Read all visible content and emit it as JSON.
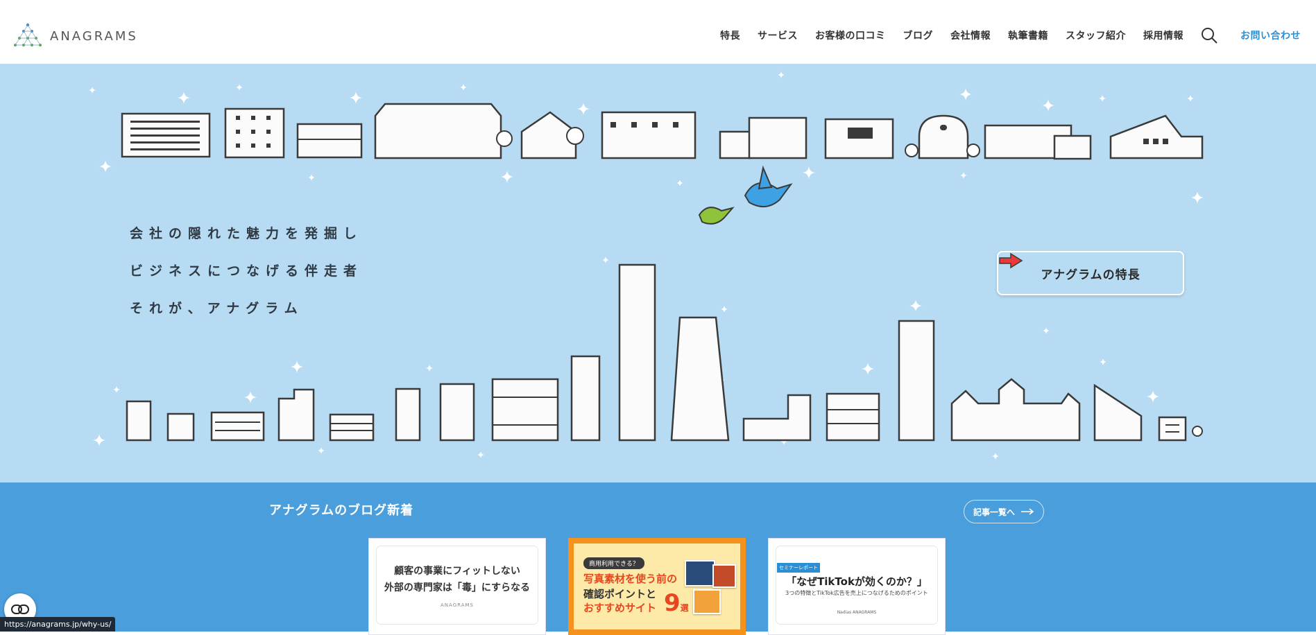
{
  "site": {
    "logo_text": "ANAGRAMS"
  },
  "nav": {
    "items": [
      "特長",
      "サービス",
      "お客様の口コミ",
      "ブログ",
      "会社情報",
      "執筆書籍",
      "スタッフ紹介",
      "採用情報"
    ],
    "contact": "お問い合わせ",
    "search_icon": "search-icon"
  },
  "hero": {
    "tagline": [
      "会社の隠れた魅力を発掘し",
      "ビジネスにつなげる伴走者",
      "それが、アナグラム"
    ],
    "feature_button": "アナグラムの特長"
  },
  "blog": {
    "title": "アナグラムのブログ新着",
    "all_posts": "記事一覧へ",
    "cards": [
      {
        "line1": "顧客の事業にフィットしない",
        "line2": "外部の専門家は「毒」にすらなる",
        "brand": "ANAGRAMS"
      },
      {
        "tag": "商用利用できる？",
        "line1": "写真素材を使う前の",
        "line2": "確認ポイントと",
        "line3": "おすすめサイト",
        "number": "9",
        "suffix": "選"
      },
      {
        "label": "セミナーレポート",
        "title": "「なぜTikTokが効くのか？」",
        "sub": "3つの特徴とTikTok広告を売上につなげるためのポイント",
        "logos": "Nadias  ANAGRAMS"
      }
    ]
  },
  "status_bar": {
    "url": "https://anagrams.jp/why-us/"
  },
  "colors": {
    "hero_bg": "#b7dbf3",
    "blog_bg": "#4a9edc",
    "accent": "#2c8fd6",
    "arrow": "#e83a3a"
  }
}
